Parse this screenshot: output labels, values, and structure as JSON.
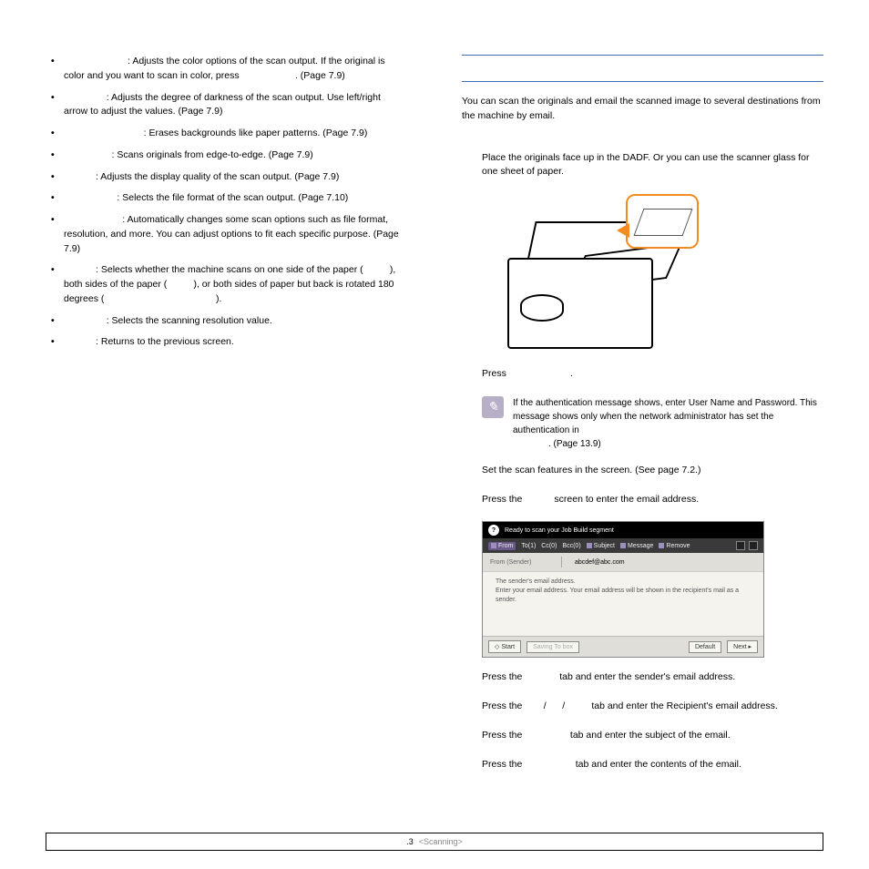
{
  "left": {
    "items": [
      {
        "rest": ": Adjusts the color options of the scan output. If the original is color and you want to scan in color, press",
        "tail": ". (Page 7.9)"
      },
      {
        "rest": ": Adjusts the degree of darkness of the scan output. Use left/right arrow to adjust the values. (Page 7.9)"
      },
      {
        "rest": ": Erases backgrounds like paper patterns. (Page 7.9)"
      },
      {
        "rest": ": Scans originals from edge-to-edge. (Page 7.9)"
      },
      {
        "rest": ": Adjusts the display quality of the scan output. (Page 7.9)"
      },
      {
        "rest": ": Selects the file format of the scan output. (Page 7.10)"
      },
      {
        "rest": ": Automatically changes some scan options such as file format, resolution, and more. You can adjust options to fit each specific purpose. (Page 7.9)"
      },
      {
        "rest": ": Selects whether the machine scans on one side of the paper (",
        "mid1": "), both sides of the paper (",
        "mid2": "), or both sides of paper but back is rotated 180 degrees (",
        "tail": ")."
      },
      {
        "rest": ": Selects the scanning resolution value."
      },
      {
        "rest": ": Returns to the previous screen."
      }
    ]
  },
  "right": {
    "intro": "You can scan the originals and email the scanned image to several destinations from the machine by email.",
    "step1": "Place the originals face up in the DADF. Or you can use the scanner glass for one sheet of paper.",
    "step2_a": "Press",
    "step2_b": ".",
    "note": "If the authentication message shows, enter User Name and Password. This message shows only when the network administrator has set the authentication in",
    "note_tail": ". (Page 13.9)",
    "step3": "Set the scan features in the screen. (See  page 7.2.)",
    "step4_a": "Press the",
    "step4_b": "screen to enter the email address.",
    "step5_a": "Press the",
    "step5_b": "tab and enter the sender's email address.",
    "step6_a": "Press the",
    "step6_slashes_b": "/",
    "step6_slashes_c": "/",
    "step6_d": "tab and enter the Recipient's email address.",
    "step7_a": "Press the",
    "step7_b": "tab and enter the subject of the email.",
    "step8_a": "Press the",
    "step8_b": "tab and enter the contents of the email."
  },
  "ui": {
    "header": "Ready to scan your Job Build segment",
    "tabs": {
      "from": "From",
      "to": "To(1)",
      "cc": "Cc(0)",
      "bcc": "Bcc(0)",
      "subject": "Subject",
      "message": "Message",
      "remove": "Remove"
    },
    "row_label": "From (Sender)",
    "row_value": "abcdef@abc.com",
    "hint1": "The sender's email address.",
    "hint2": "Enter your email address. Your email address will be shown in the recipient's mail as a sender.",
    "btn_start": "◇ Start",
    "btn_saving": "Saving To box",
    "btn_default": "Default",
    "btn_next": "Next ▸"
  },
  "footer": {
    "num": ".3",
    "section": "<Scanning>"
  }
}
